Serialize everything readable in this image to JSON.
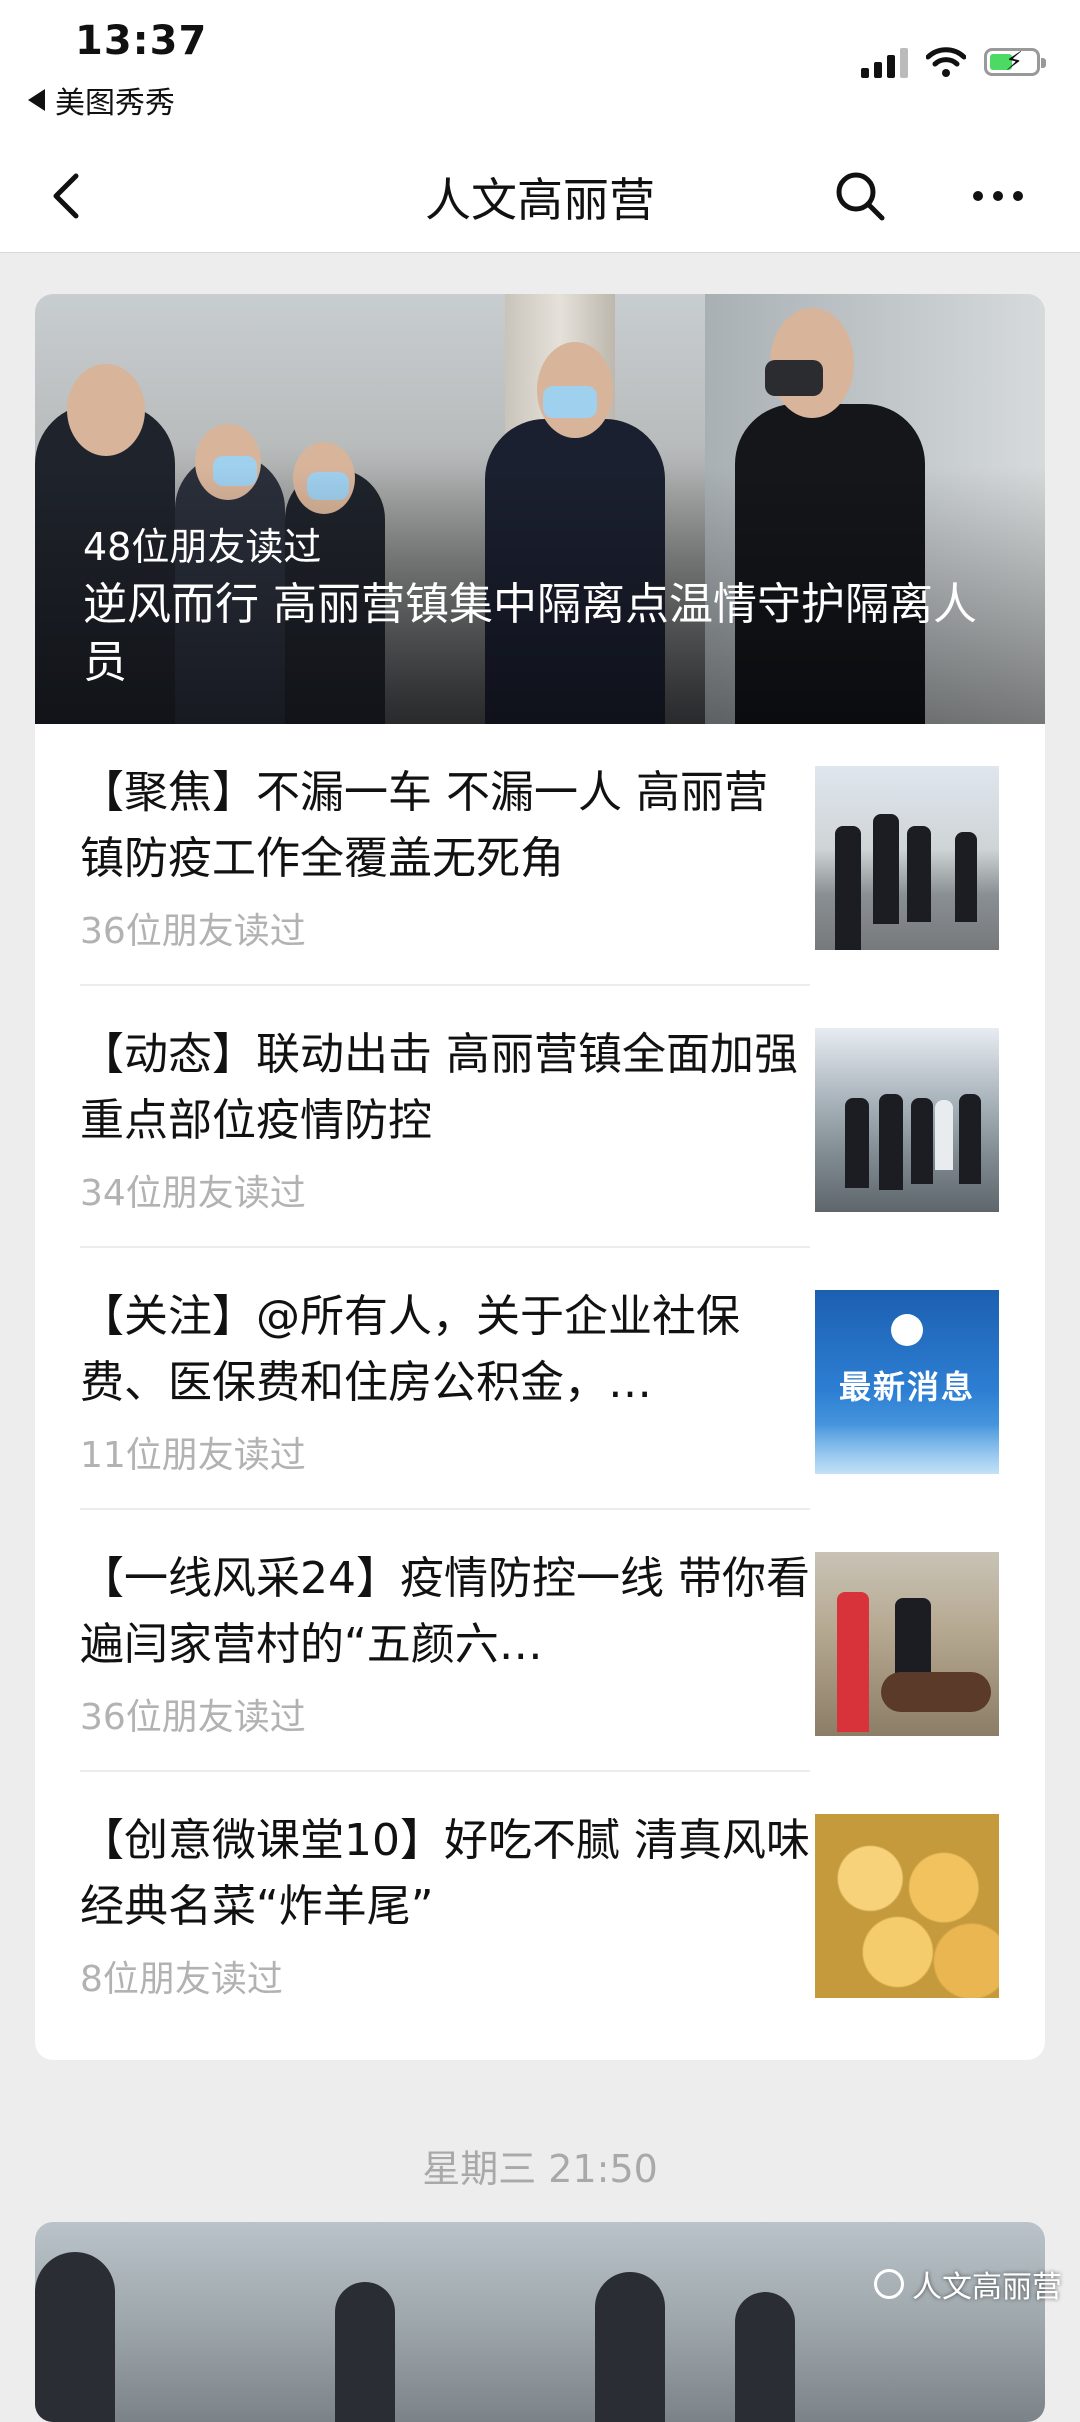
{
  "status_bar": {
    "time": "13:37",
    "back_app_label": "美图秀秀"
  },
  "nav": {
    "title": "人文高丽营"
  },
  "hero": {
    "reads": "48位朋友读过",
    "title": "逆风而行 高丽营镇集中隔离点温情守护隔离人员"
  },
  "articles": [
    {
      "title": "【聚焦】不漏一车 不漏一人 高丽营镇防疫工作全覆盖无死角",
      "reads": "36位朋友读过"
    },
    {
      "title": "【动态】联动出击 高丽营镇全面加强重点部位疫情防控",
      "reads": "34位朋友读过"
    },
    {
      "title": "【关注】@所有人，关于企业社保费、医保费和住房公积金，…",
      "reads": "11位朋友读过",
      "thumb_text": "最新消息"
    },
    {
      "title": "【一线风采24】疫情防控一线 带你看遍闫家营村的“五颜六…",
      "reads": "36位朋友读过"
    },
    {
      "title": "【创意微课堂10】好吃不腻 清真风味经典名菜“炸羊尾”",
      "reads": "8位朋友读过"
    }
  ],
  "next_date": "星期三 21:50",
  "watermark": "人文高丽营",
  "colors": {
    "background": "#ededed",
    "card": "#ffffff",
    "muted_text": "#b2b2b2",
    "battery_green": "#4cd964"
  },
  "icons": {
    "back": "chevron-left",
    "search": "magnifier",
    "more": "three-dots",
    "wifi": "wifi",
    "signal": "cellular-bars",
    "battery": "battery-charging"
  }
}
